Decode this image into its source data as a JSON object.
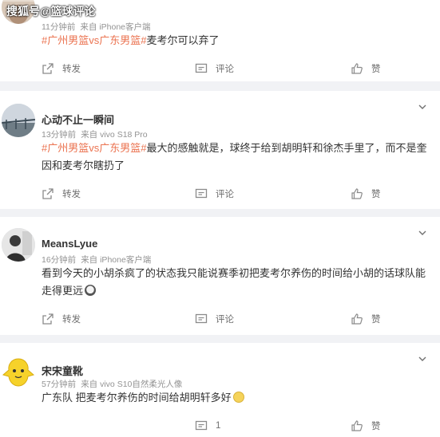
{
  "watermark": "搜狐号@篮球评论",
  "colors": {
    "topic": "#eb7350",
    "meta": "#939393",
    "background": "#f1f2f5"
  },
  "actions": {
    "repost": "转发",
    "comment": "评论",
    "like": "赞"
  },
  "comments": [
    {
      "name": "",
      "time": "11分钟前",
      "source": "来自 iPhone客户端",
      "content": {
        "topics": [
          "#广州男篮vs广东男篮#"
        ],
        "text": "麦考尔可以弃了"
      },
      "avatar_icon": "avatar-photo",
      "like_count": ""
    },
    {
      "name": "心动不止一瞬间",
      "time": "13分钟前",
      "source": "来自 vivo S18 Pro",
      "content": {
        "topics": [
          "#广州男篮vs广东男篮#"
        ],
        "text": "最大的感触就是，球终于给到胡明轩和徐杰手里了，而不是奎因和麦考尔瞎扔了"
      },
      "avatar_icon": "avatar-bridge-photo",
      "like_count": ""
    },
    {
      "name": "MeansLyue",
      "time": "16分钟前",
      "source": "来自 iPhone客户端",
      "content": {
        "topics": [],
        "text": "看到今天的小胡杀疯了的状态我只能说赛季初把麦考尔养伤的时间给小胡的话球队能走得更远"
      },
      "content_emoji": "crying-face-emoji",
      "avatar_icon": "avatar-person-photo",
      "like_count": ""
    },
    {
      "name": "宋宋童靴",
      "time": "57分钟前",
      "source": "来自 vivo S10自然柔光人像",
      "content": {
        "topics": [],
        "text": "广东队 把麦考尔养伤的时间给胡明轩多好"
      },
      "content_emoji": "smirk-face-emoji",
      "avatar_icon": "avatar-yellow-cartoon",
      "reply_count": "1"
    }
  ]
}
